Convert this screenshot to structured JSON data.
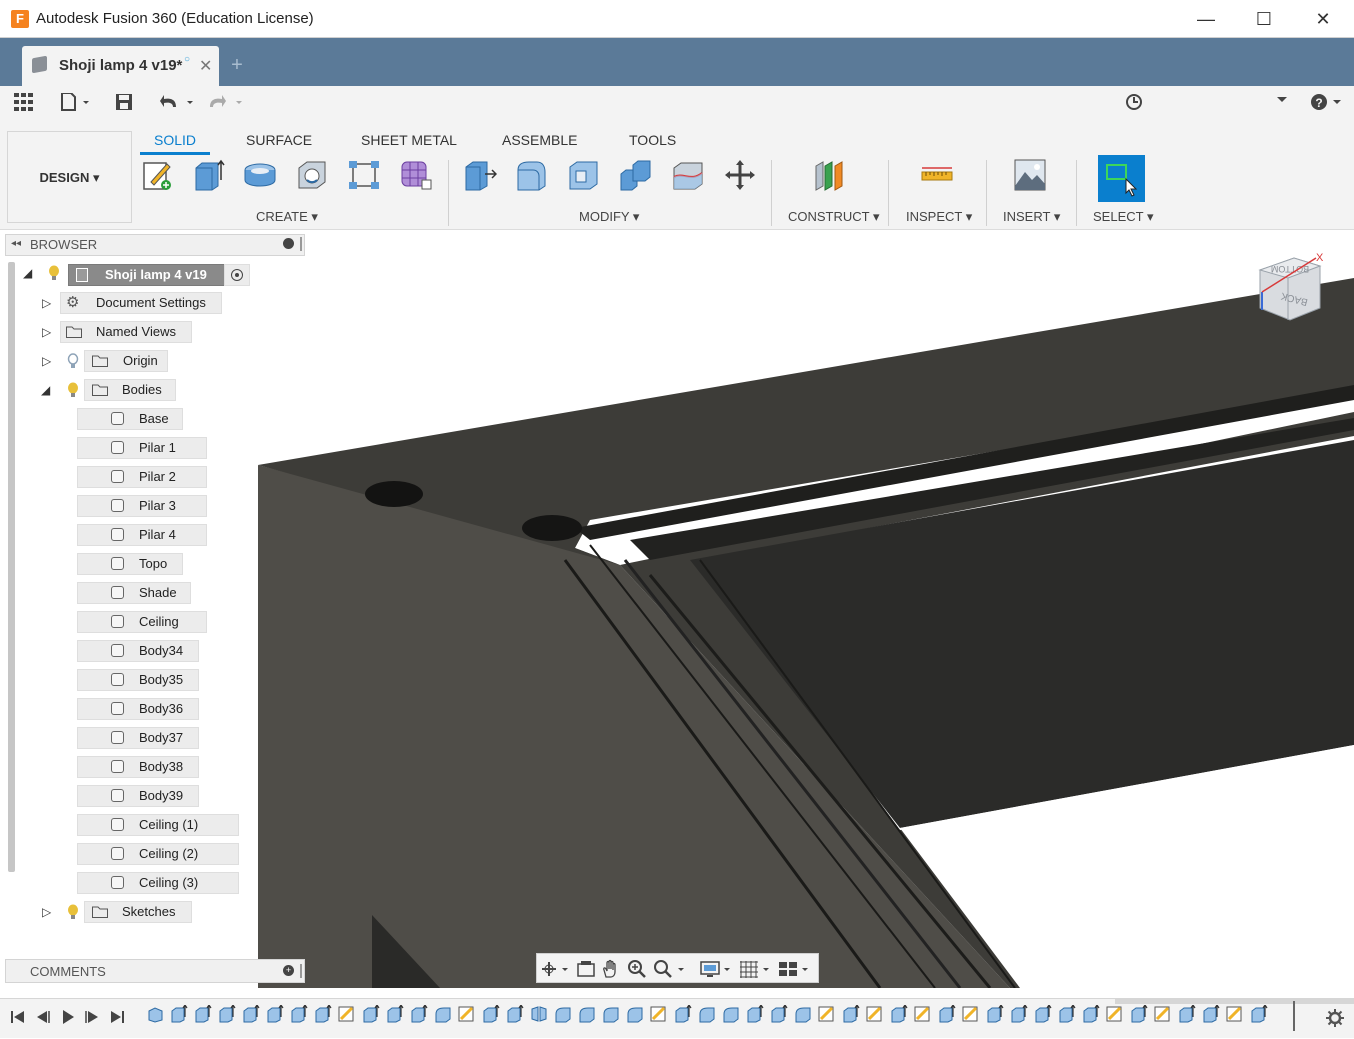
{
  "window": {
    "title": "Autodesk Fusion 360 (Education License)",
    "logo_letter": "F",
    "minimize": "—",
    "maximize": "☐",
    "close": "✕"
  },
  "tab": {
    "label": "Shoji lamp 4 v19*",
    "close": "✕",
    "new_tab": "+"
  },
  "ribbon": {
    "workspace": "DESIGN ▾",
    "tabs": [
      "SOLID",
      "SURFACE",
      "SHEET METAL",
      "ASSEMBLE",
      "TOOLS"
    ],
    "groups": [
      "CREATE ▾",
      "MODIFY ▾",
      "CONSTRUCT ▾",
      "INSPECT ▾",
      "INSERT ▾",
      "SELECT ▾"
    ]
  },
  "browser": {
    "title": "BROWSER",
    "root": "Shoji lamp 4 v19",
    "top_items": [
      {
        "label": "Document Settings"
      },
      {
        "label": "Named Views"
      },
      {
        "label": "Origin"
      },
      {
        "label": "Bodies"
      }
    ],
    "bodies": [
      "Base",
      "Pilar 1",
      "Pilar 2",
      "Pilar 3",
      "Pilar 4",
      "Topo",
      "Shade",
      "Ceiling",
      "Body34",
      "Body35",
      "Body36",
      "Body37",
      "Body38",
      "Body39",
      "Ceiling (1)",
      "Ceiling (2)",
      "Ceiling (3)"
    ],
    "sketches": "Sketches"
  },
  "comments": {
    "title": "COMMENTS"
  },
  "viewcube": {
    "face_top": "BOTTOM",
    "face_side": "BACK",
    "axis_x": "X"
  },
  "colors": {
    "accent": "#0a7fce",
    "tabbar": "#5b7a98",
    "bulb_on": "#e8c03a",
    "bulb_off": "#8fa4b8",
    "model": "#3b3b38"
  }
}
